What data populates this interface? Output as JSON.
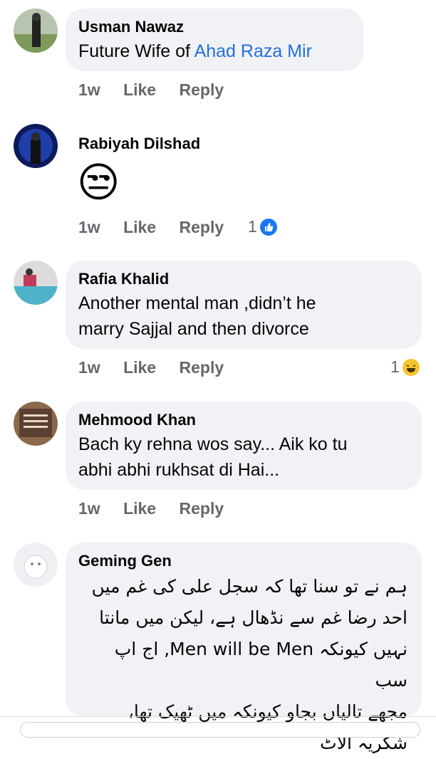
{
  "comments": [
    {
      "name": "Usman Nawaz",
      "text_prefix": "Future Wife of ",
      "text_link": "Ahad Raza Mir",
      "time": "1w",
      "like": "Like",
      "reply": "Reply"
    },
    {
      "name": "Rabiyah Dilshad",
      "emoji": "😒",
      "time": "1w",
      "like": "Like",
      "reply": "Reply",
      "reaction_count": "1",
      "reaction_icon": "thumbs-up-icon"
    },
    {
      "name": "Rafia Khalid",
      "line1": "Another mental man ,didn’t he",
      "line2": "marry Sajjal and then divorce",
      "time": "1w",
      "like": "Like",
      "reply": "Reply",
      "reaction_count": "1",
      "reaction_icon": "laughing-emoji-icon"
    },
    {
      "name": "Mehmood Khan",
      "line1": "Bach ky rehna wos say... Aik ko tu",
      "line2": "abhi abhi rukhsat di Hai...",
      "time": "1w",
      "like": "Like",
      "reply": "Reply"
    },
    {
      "name": "Geming Gen",
      "lines": [
        "ہم نے تو سنا تھا کہ سجل علی کی غم میں",
        "احد رضا غم سے نڈھال ہے، لیکن میں مانتا",
        "نہیں کیونکہ Men will be Men, اج اپ سب",
        "مجھے تالیاں بجاو کیونکہ میں ٹھیک تھا،",
        "شکریہ الاٹ"
      ]
    }
  ],
  "colors": {
    "bubble": "#f0f2f5",
    "link": "#216fdb",
    "meta": "#65676b"
  }
}
